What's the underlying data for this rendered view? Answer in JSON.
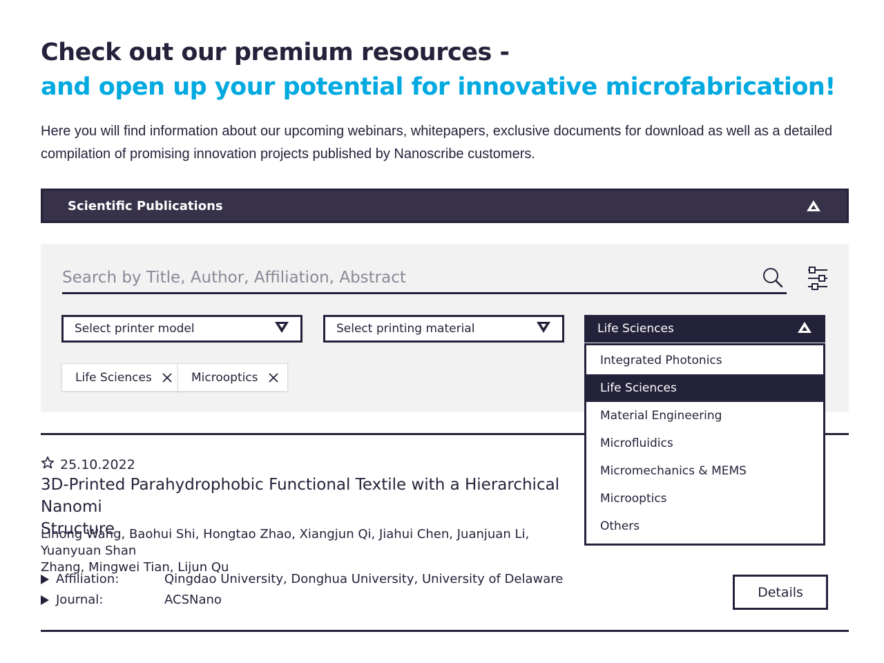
{
  "hero": {
    "title_line1": "Check out our premium resources -",
    "title_line2": "and open up your potential for innovative microfabrication!",
    "intro": "Here you will find information about our upcoming webinars, whitepapers, exclusive documents for download as well as a detailed compilation of promising innovation projects published by Nanoscribe customers."
  },
  "accordion": {
    "title": "Scientific Publications",
    "state_icon": "triangle-up-icon"
  },
  "search": {
    "placeholder": "Search by Title, Author, Affiliation, Abstract",
    "value": ""
  },
  "filters": {
    "printer_model": {
      "label": "Select printer model"
    },
    "printing_material": {
      "label": "Select printing material"
    },
    "application": {
      "label": "Life Sciences",
      "open": true,
      "options": [
        "Integrated Photonics",
        "Life Sciences",
        "Material Engineering",
        "Microfluidics",
        "Micromechanics & MEMS",
        "Microoptics",
        "Others"
      ],
      "selected": "Life Sciences"
    },
    "chips": [
      "Life Sciences",
      "Microoptics"
    ]
  },
  "publication": {
    "date": "25.10.2022",
    "title": "3D-Printed Parahydrophobic Functional Textile with a Hierarchical Nanomi",
    "title_line2": "Structure",
    "authors_line1": "Lihong Wang, Baohui Shi, Hongtao Zhao, Xiangjun Qi, Jiahui Chen, Juanjuan Li, Yuanyuan Shan",
    "authors_line2": "Zhang, Mingwei Tian, Lijun Qu",
    "affiliation_label": "Affiliation:",
    "affiliation_value": "Qingdao University, Donghua University, University of Delaware",
    "journal_label": "Journal:",
    "journal_value": "ACSNano",
    "details_label": "Details"
  },
  "colors": {
    "navy": "#23223a",
    "accent": "#00a9e0",
    "header_bg": "#373149",
    "panel_bg": "#f2f2f2"
  }
}
